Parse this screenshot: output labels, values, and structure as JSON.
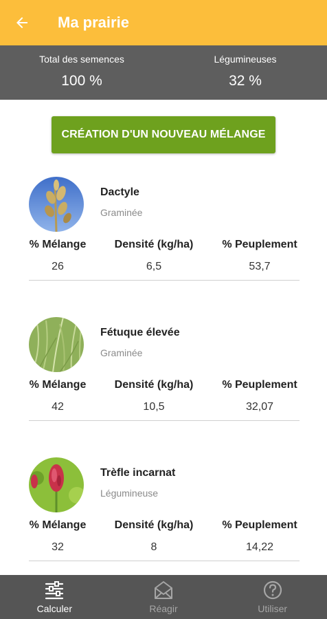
{
  "header": {
    "title": "Ma prairie",
    "back_icon": "arrow-left-icon",
    "color": "#fcbe3b"
  },
  "summary": {
    "total_label": "Total des semences",
    "total_value": "100 %",
    "legumes_label": "Légumineuses",
    "legumes_value": "32 %"
  },
  "new_mix_button": "CRÉATION D'UN NOUVEAU MÉLANGE",
  "columns": {
    "mix": "% Mélange",
    "density": "Densité (kg/ha)",
    "stand": "% Peuplement"
  },
  "species": [
    {
      "name": "Dactyle",
      "type": "Graminée",
      "mix": "26",
      "density": "6,5",
      "stand": "53,7",
      "image": "grass-seedhead-image"
    },
    {
      "name": "Fétuque élevée",
      "type": "Graminée",
      "mix": "42",
      "density": "10,5",
      "stand": "32,07",
      "image": "grass-blades-image"
    },
    {
      "name": "Trèfle incarnat",
      "type": "Légumineuse",
      "mix": "32",
      "density": "8",
      "stand": "14,22",
      "image": "crimson-clover-image"
    }
  ],
  "bottom_nav": {
    "tabs": [
      {
        "label": "Calculer",
        "icon": "sliders-icon",
        "active": true
      },
      {
        "label": "Réagir",
        "icon": "mail-icon",
        "active": false
      },
      {
        "label": "Utiliser",
        "icon": "help-circle-icon",
        "active": false
      }
    ]
  },
  "colors": {
    "accent": "#fcbe3b",
    "button": "#6ea11e",
    "summary_bg": "#5e5e5e",
    "nav_bg": "#555555"
  }
}
